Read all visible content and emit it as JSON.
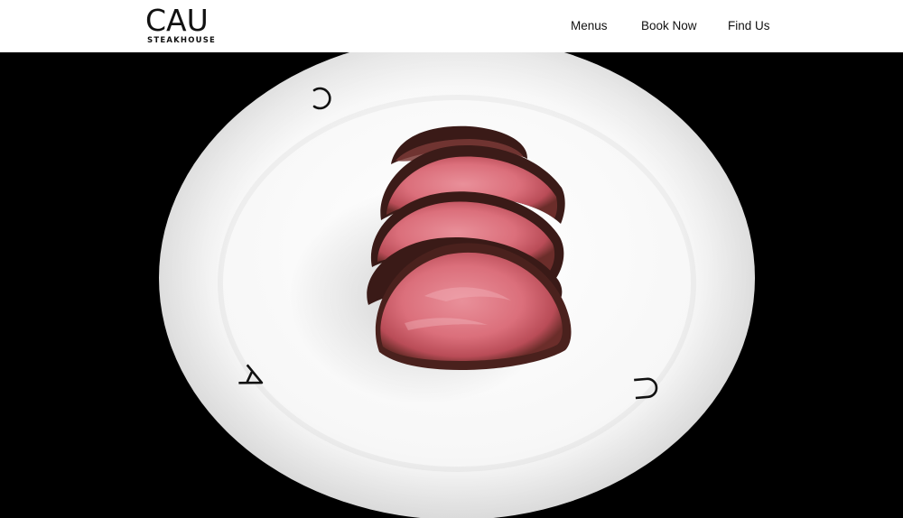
{
  "brand": {
    "name": "CAU",
    "tagline": "STEAKHOUSE"
  },
  "nav": {
    "items": [
      {
        "label": "Menus"
      },
      {
        "label": "Book Now"
      },
      {
        "label": "Find Us"
      }
    ]
  },
  "hero": {
    "image": "steak-on-plate-photo",
    "plate_letters": [
      "C",
      "A",
      "U"
    ]
  },
  "colors": {
    "header_background": "#ffffff",
    "hero_background": "#000000",
    "text": "#111111"
  }
}
